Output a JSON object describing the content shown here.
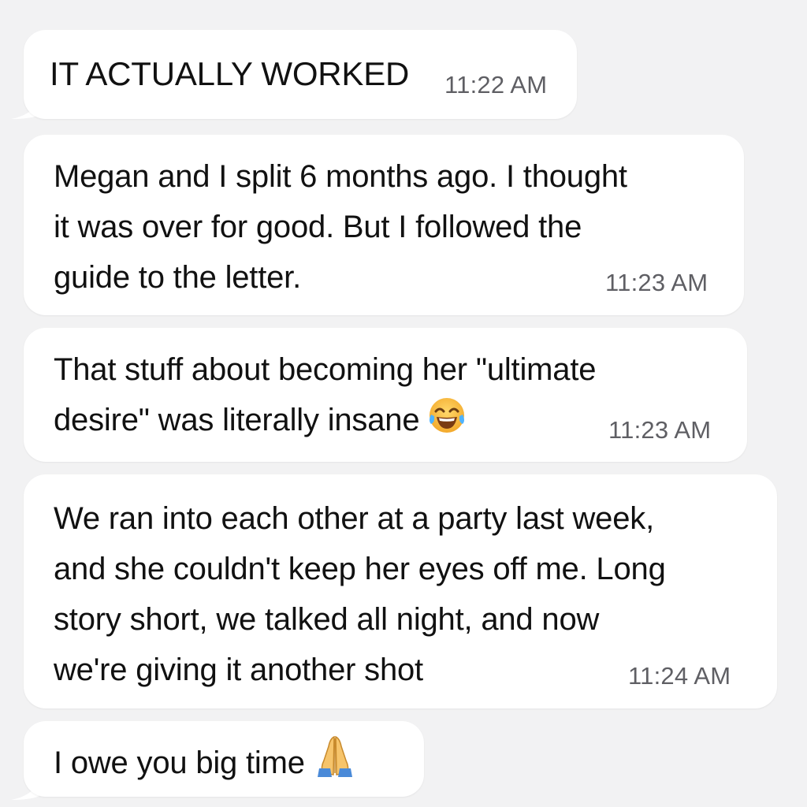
{
  "conversation": {
    "messages": [
      {
        "text": "IT ACTUALLY WORKED",
        "time": "11:22 AM"
      },
      {
        "text": "Megan and I split 6 months ago. I thought\nit was over for good. But I followed the\nguide to the letter.",
        "time": "11:23 AM"
      },
      {
        "text": "That stuff about becoming her \"ultimate\ndesire\" was literally insane",
        "emoji": "face-with-tears-of-joy-icon",
        "time": "11:23 AM"
      },
      {
        "text": "We ran into each other at a party last week,\nand she couldn't keep her eyes off me. Long\nstory short, we talked all night, and now\nwe're giving it another shot",
        "time": "11:24 AM"
      },
      {
        "text": "I owe you big time",
        "emoji": "folded-hands-icon"
      }
    ]
  },
  "colors": {
    "background": "#f2f2f3",
    "bubble": "#ffffff",
    "text": "#111111",
    "timestamp": "#5f5f64"
  }
}
